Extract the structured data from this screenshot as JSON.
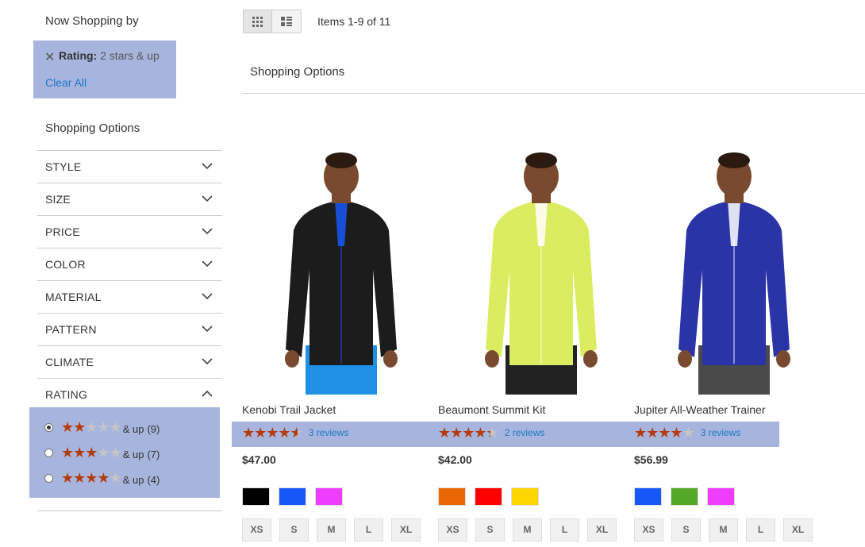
{
  "sidebar": {
    "now_shopping_title": "Now Shopping by",
    "active_filter": {
      "label": "Rating:",
      "value": "2 stars & up"
    },
    "clear_all": "Clear All",
    "shopping_options_title": "Shopping Options",
    "filters": [
      {
        "label": "STYLE",
        "expanded": false
      },
      {
        "label": "SIZE",
        "expanded": false
      },
      {
        "label": "PRICE",
        "expanded": false
      },
      {
        "label": "COLOR",
        "expanded": false
      },
      {
        "label": "MATERIAL",
        "expanded": false
      },
      {
        "label": "PATTERN",
        "expanded": false
      },
      {
        "label": "CLIMATE",
        "expanded": false
      },
      {
        "label": "RATING",
        "expanded": true
      }
    ],
    "rating_options": [
      {
        "stars": 2,
        "and_up": "& up",
        "count": "(9)",
        "selected": true
      },
      {
        "stars": 3,
        "and_up": "& up",
        "count": "(7)",
        "selected": false
      },
      {
        "stars": 4,
        "and_up": "& up",
        "count": "(4)",
        "selected": false
      }
    ]
  },
  "toolbar": {
    "view_modes": [
      "grid",
      "list"
    ],
    "active_mode": "grid",
    "items_count": "Items 1-9 of 11",
    "shopping_options_label": "Shopping Options"
  },
  "products": [
    {
      "name": "Kenobi Trail Jacket",
      "rating_percent": 93,
      "reviews": "3 reviews",
      "price": "$47.00",
      "colors": [
        "#000000",
        "#1857f7",
        "#ef3dff"
      ],
      "sizes": [
        "XS",
        "S",
        "M",
        "L",
        "XL"
      ],
      "image": {
        "jacket": "#1c1c1c",
        "accent": "#1857f7",
        "pants": "#1e90e6"
      }
    },
    {
      "name": "Beaumont Summit Kit",
      "rating_percent": 87,
      "reviews": "2 reviews",
      "price": "$42.00",
      "colors": [
        "#eb6703",
        "#ff0000",
        "#ffd500"
      ],
      "sizes": [
        "XS",
        "S",
        "M",
        "L",
        "XL"
      ],
      "image": {
        "jacket": "#dcec60",
        "accent": "#ffffff",
        "pants": "#222222"
      }
    },
    {
      "name": "Jupiter All-Weather Trainer",
      "rating_percent": 80,
      "reviews": "3 reviews",
      "price": "$56.99",
      "colors": [
        "#1857f7",
        "#53a828",
        "#ef3dff"
      ],
      "sizes": [
        "XS",
        "S",
        "M",
        "L",
        "XL"
      ],
      "image": {
        "jacket": "#2b34a6",
        "accent": "#ffffff",
        "pants": "#4a4a4a"
      }
    }
  ]
}
